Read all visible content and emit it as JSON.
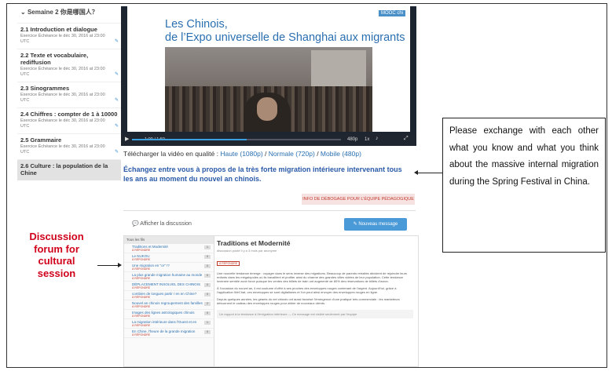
{
  "sidebar": {
    "week_title": "Semaine 2 你是哪国人？",
    "lessons": [
      {
        "title": "2.1 Introduction et dialogue",
        "due": "Exercice Échéance le déc 30, 2016 at 23:00 UTC"
      },
      {
        "title": "2.2 Texte et vocabulaire, rediffusion",
        "due": "Exercice Échéance le déc 30, 2016 at 23:00 UTC"
      },
      {
        "title": "2.3 Sinogrammes",
        "due": "Exercice Échéance le déc 30, 2016 at 23:00 UTC"
      },
      {
        "title": "2.4 Chiffres : compter de 1 à 10000",
        "due": "Exercice Échéance le déc 30, 2016 at 23:00 UTC"
      },
      {
        "title": "2.5 Grammaire",
        "due": "Exercice Échéance le déc 30, 2016 at 23:00 UTC"
      },
      {
        "title": "2.6 Culture : la population de la Chine",
        "due": ""
      }
    ],
    "edit_icon": "edit-icon"
  },
  "video": {
    "slide_title_line1": "Les Chinois,",
    "slide_title_line2": "de l’Expo universelle de Shanghai aux migrants",
    "brand_badge": "MOOC chi",
    "time_text": "1:00 / 1:50",
    "quality": "480p",
    "speed": "1x",
    "progress": 0.55,
    "accent_color": "#3aa0e0"
  },
  "download": {
    "prefix": "Télécharger la vidéo en qualité : ",
    "high": "Haute (1080p)",
    "sep1": " / ",
    "normal": "Normale (720p)",
    "sep2": " / ",
    "mobile": "Mobile (480p)"
  },
  "question": "Échangez entre vous à propos de la très forte migration intérieure intervenant tous les ans au moment du nouvel an chinois.",
  "debug_label": "INFO DE DÉBOGAGE POUR L’ÉQUIPE PÉDAGOGIQUE",
  "discussion": {
    "show_label": "Afficher la discussion",
    "new_message": "Nouveau message",
    "list_header": "Tous les fils",
    "threads": [
      {
        "title": "Traditions et Modernité",
        "count": "1"
      },
      {
        "title": "Le NUKOU",
        "count": "0"
      },
      {
        "title": "Une migration en \"or\" !?",
        "count": "0"
      },
      {
        "title": "La plus grande migration humaine au monde",
        "count": "0"
      },
      {
        "title": "DÉPLACEMENT INSOLVEL DES CHINOIS",
        "count": "0"
      },
      {
        "title": "combien de longues partir / en en Chine?",
        "count": "0"
      },
      {
        "title": "Nouvel an chinois regroupement des familles",
        "count": "2"
      },
      {
        "title": "Images des lignes astrologiques chinois",
        "count": "0"
      },
      {
        "title": "La migration intérieure dans l'Ouest et en",
        "count": "1"
      },
      {
        "title": "En Chine, l'heure de la grande migration",
        "count": "0"
      }
    ],
    "thread_tag": "À RÉPONDRE",
    "post_title": "Traditions et Modernité",
    "post_meta": "discussion posté il y a 3 mois par anonyme",
    "post_tag": "À RÉPONDRE",
    "post_paragraphs": [
      "Une nouvelle tendance émerge : voyager dans le sens inverse des migrations. Beaucoup de parents retraités décident de rejoindre leurs enfants dans les mégalopoles où ils travaillent et profiter ainsi du charme des grandes villes vidées de leur population. Cette tendance inversée semble avoir force puisque les ventes des billets de train ont augmenté de 80% des réservations de billets d'avion.",
      "À l'occasion du nouvel an, il est coutume d'offrir à ses proches des enveloppes rouges contenant de l'argent. Aujourd'hui, grâce à l'application WeChat, ces enveloppes se sont digitalisées et l'on peut ainsi envoyer des enveloppes rouges en ligne.",
      "Depuis quelques années, les géants du net chinois ont aussi favorisé l'émergence d'une pratique très commerciale : les marketeurs détournent le cadeau des enveloppes rouges pour attirer de nouveaux clients."
    ],
    "reply_note": "Un rapport à la tendance à l'émigration intérieure — Ce message est visible seulement par l'équipe"
  },
  "callout_right": "Please exchange with each other what you know and what you think about the massive internal migration during the Spring Festival in China.",
  "callout_left": "Discussion forum for cultural session"
}
